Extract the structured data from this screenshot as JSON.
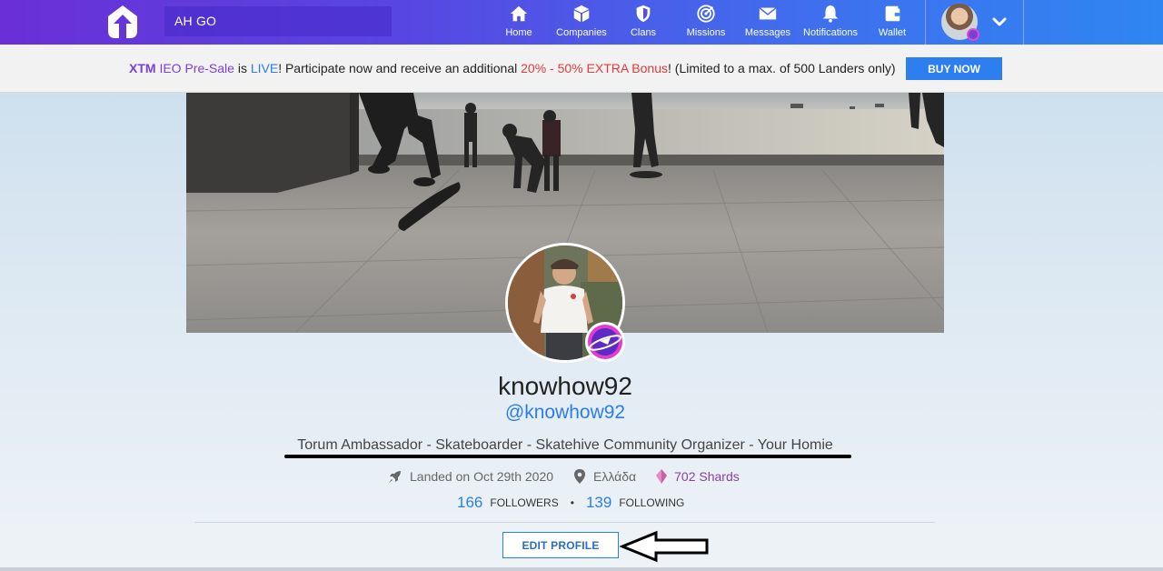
{
  "nav": {
    "search_value": "AH GO",
    "items": [
      {
        "label": "Home",
        "icon": "home-icon"
      },
      {
        "label": "Companies",
        "icon": "cube-icon"
      },
      {
        "label": "Clans",
        "icon": "shield-icon"
      },
      {
        "label": "Missions",
        "icon": "target-icon"
      },
      {
        "label": "Messages",
        "icon": "envelope-icon"
      },
      {
        "label": "Notifications",
        "icon": "bell-icon"
      },
      {
        "label": "Wallet",
        "icon": "wallet-icon"
      }
    ]
  },
  "announcement": {
    "part1": "XTM",
    "part2": " IEO Pre-Sale",
    "part3": " is ",
    "part4": "LIVE",
    "part5": "! Participate now and receive an additional ",
    "part6": "20% - 50% EXTRA Bonus",
    "part7": "! (Limited to a max. of 500 Landers only)",
    "button": "BUY NOW"
  },
  "profile": {
    "username": "knowhow92",
    "handle": "@knowhow92",
    "bio": "Torum Ambassador - Skateboarder - Skatehive Community Organizer - Your Homie",
    "landed": "Landed on Oct 29th 2020",
    "location": "Ελλάδα",
    "shards": "702 Shards",
    "followers_count": "166",
    "followers_label": "FOLLOWERS",
    "following_count": "139",
    "following_label": "FOLLOWING",
    "edit_button": "EDIT PROFILE"
  },
  "colors": {
    "accent_blue": "#2b7de9",
    "nav_purple": "#6a2fd6",
    "bonus_red": "#e03a3a",
    "shard_purple": "#8a3fa0"
  }
}
